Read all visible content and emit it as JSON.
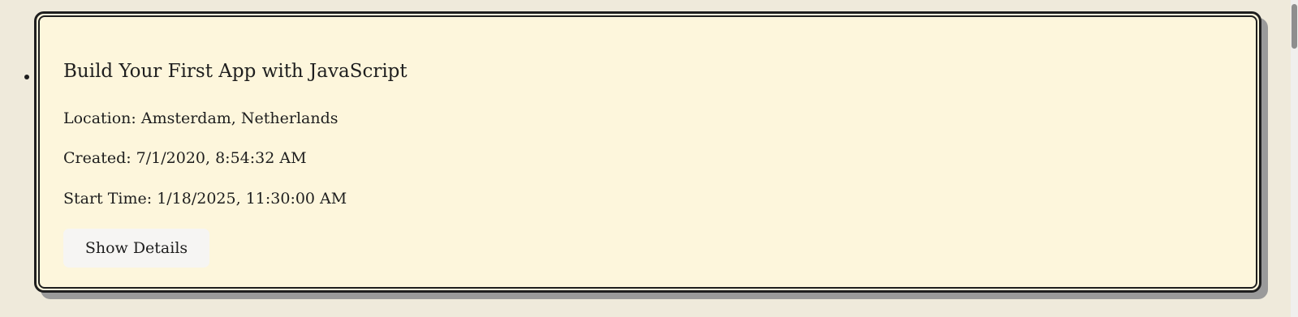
{
  "event": {
    "title": "Build Your First App with JavaScript",
    "location": "Location: Amsterdam, Netherlands",
    "created": "Created: 7/1/2020, 8:54:32 AM",
    "start_time": "Start Time: 1/18/2025, 11:30:00 AM",
    "details_button_label": "Show Details"
  },
  "colors": {
    "page_background": "#efeadb",
    "card_background": "#fdf6dc",
    "card_border": "#1e1e1e",
    "card_shadow": "#9a9a9a",
    "button_background": "#f6f5f3"
  }
}
